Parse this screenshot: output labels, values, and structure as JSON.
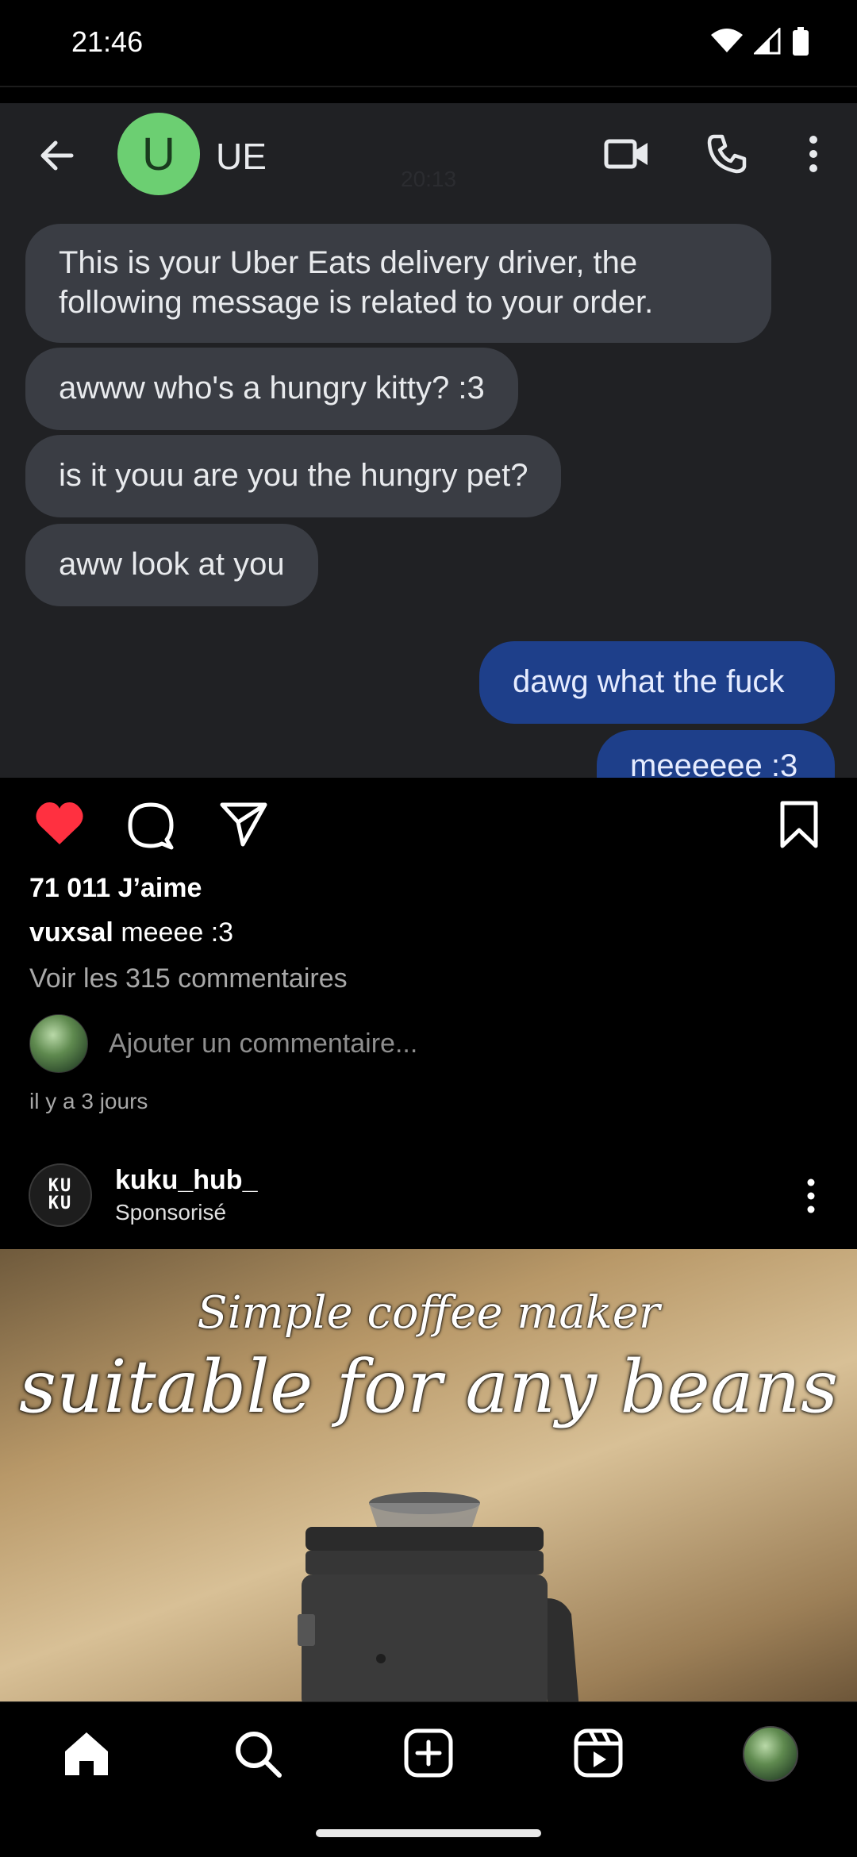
{
  "status_bar": {
    "time": "21:46"
  },
  "post1": {
    "chat": {
      "contact_initial": "U",
      "contact_name": "UE",
      "ghost_time": "20:13",
      "messages": [
        "This is your Uber Eats delivery driver, the following message is related to your order.",
        "awww who's a hungry kitty? :3",
        "is it youu are you the hungry pet?",
        "aww look at you",
        "dawg what the fuck",
        "meeeeee :3"
      ]
    },
    "likes": "71 011 J’aime",
    "caption_user": "vuxsal",
    "caption_text": "meeee :3",
    "view_comments": "Voir les 315 commentaires",
    "comment_placeholder": "Ajouter un commentaire...",
    "time_ago": "il y a 3 jours",
    "liked": true,
    "like_color": "#ff3040"
  },
  "post2": {
    "brand_logo_text": "KU\nKU",
    "username": "kuku_hub_",
    "sponsored_label": "Sponsorisé",
    "ad_line1": "Simple coffee maker",
    "ad_line2": "suitable for any beans"
  },
  "nav": {
    "items": [
      "home-icon",
      "search-icon",
      "create-icon",
      "reels-icon",
      "profile-avatar"
    ]
  }
}
